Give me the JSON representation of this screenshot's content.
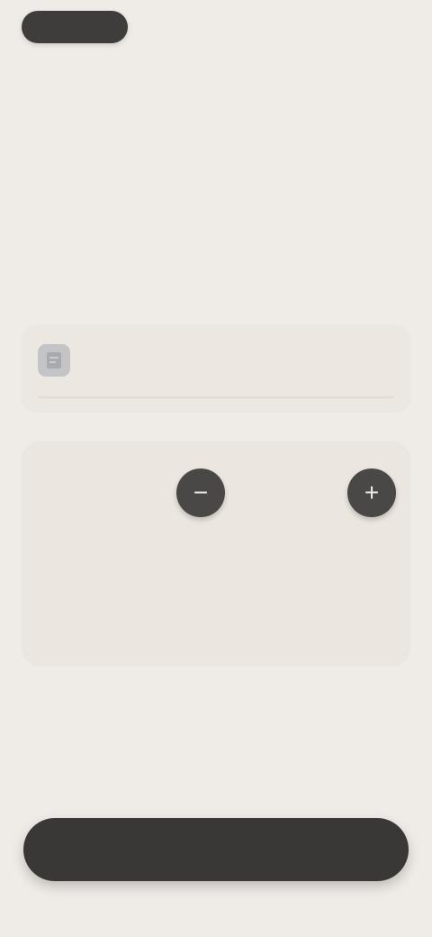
{
  "topbar": {
    "left_button_label": "",
    "right_link_label": ""
  },
  "hero": {
    "headline": "",
    "subtext": ""
  },
  "card": {
    "icon": "document-icon",
    "title": "",
    "subtitle": ""
  },
  "panel": {
    "stepper": {
      "label": "",
      "value": "",
      "decrement_icon": "minus-icon",
      "increment_icon": "plus-icon"
    },
    "rows": [
      {
        "label": "",
        "value": ""
      },
      {
        "label": "",
        "value": ""
      }
    ]
  },
  "cta": {
    "label": ""
  },
  "colors": {
    "background": "#efebe6",
    "primary_dark": "#3a3836",
    "panel": "#ebe6df"
  }
}
